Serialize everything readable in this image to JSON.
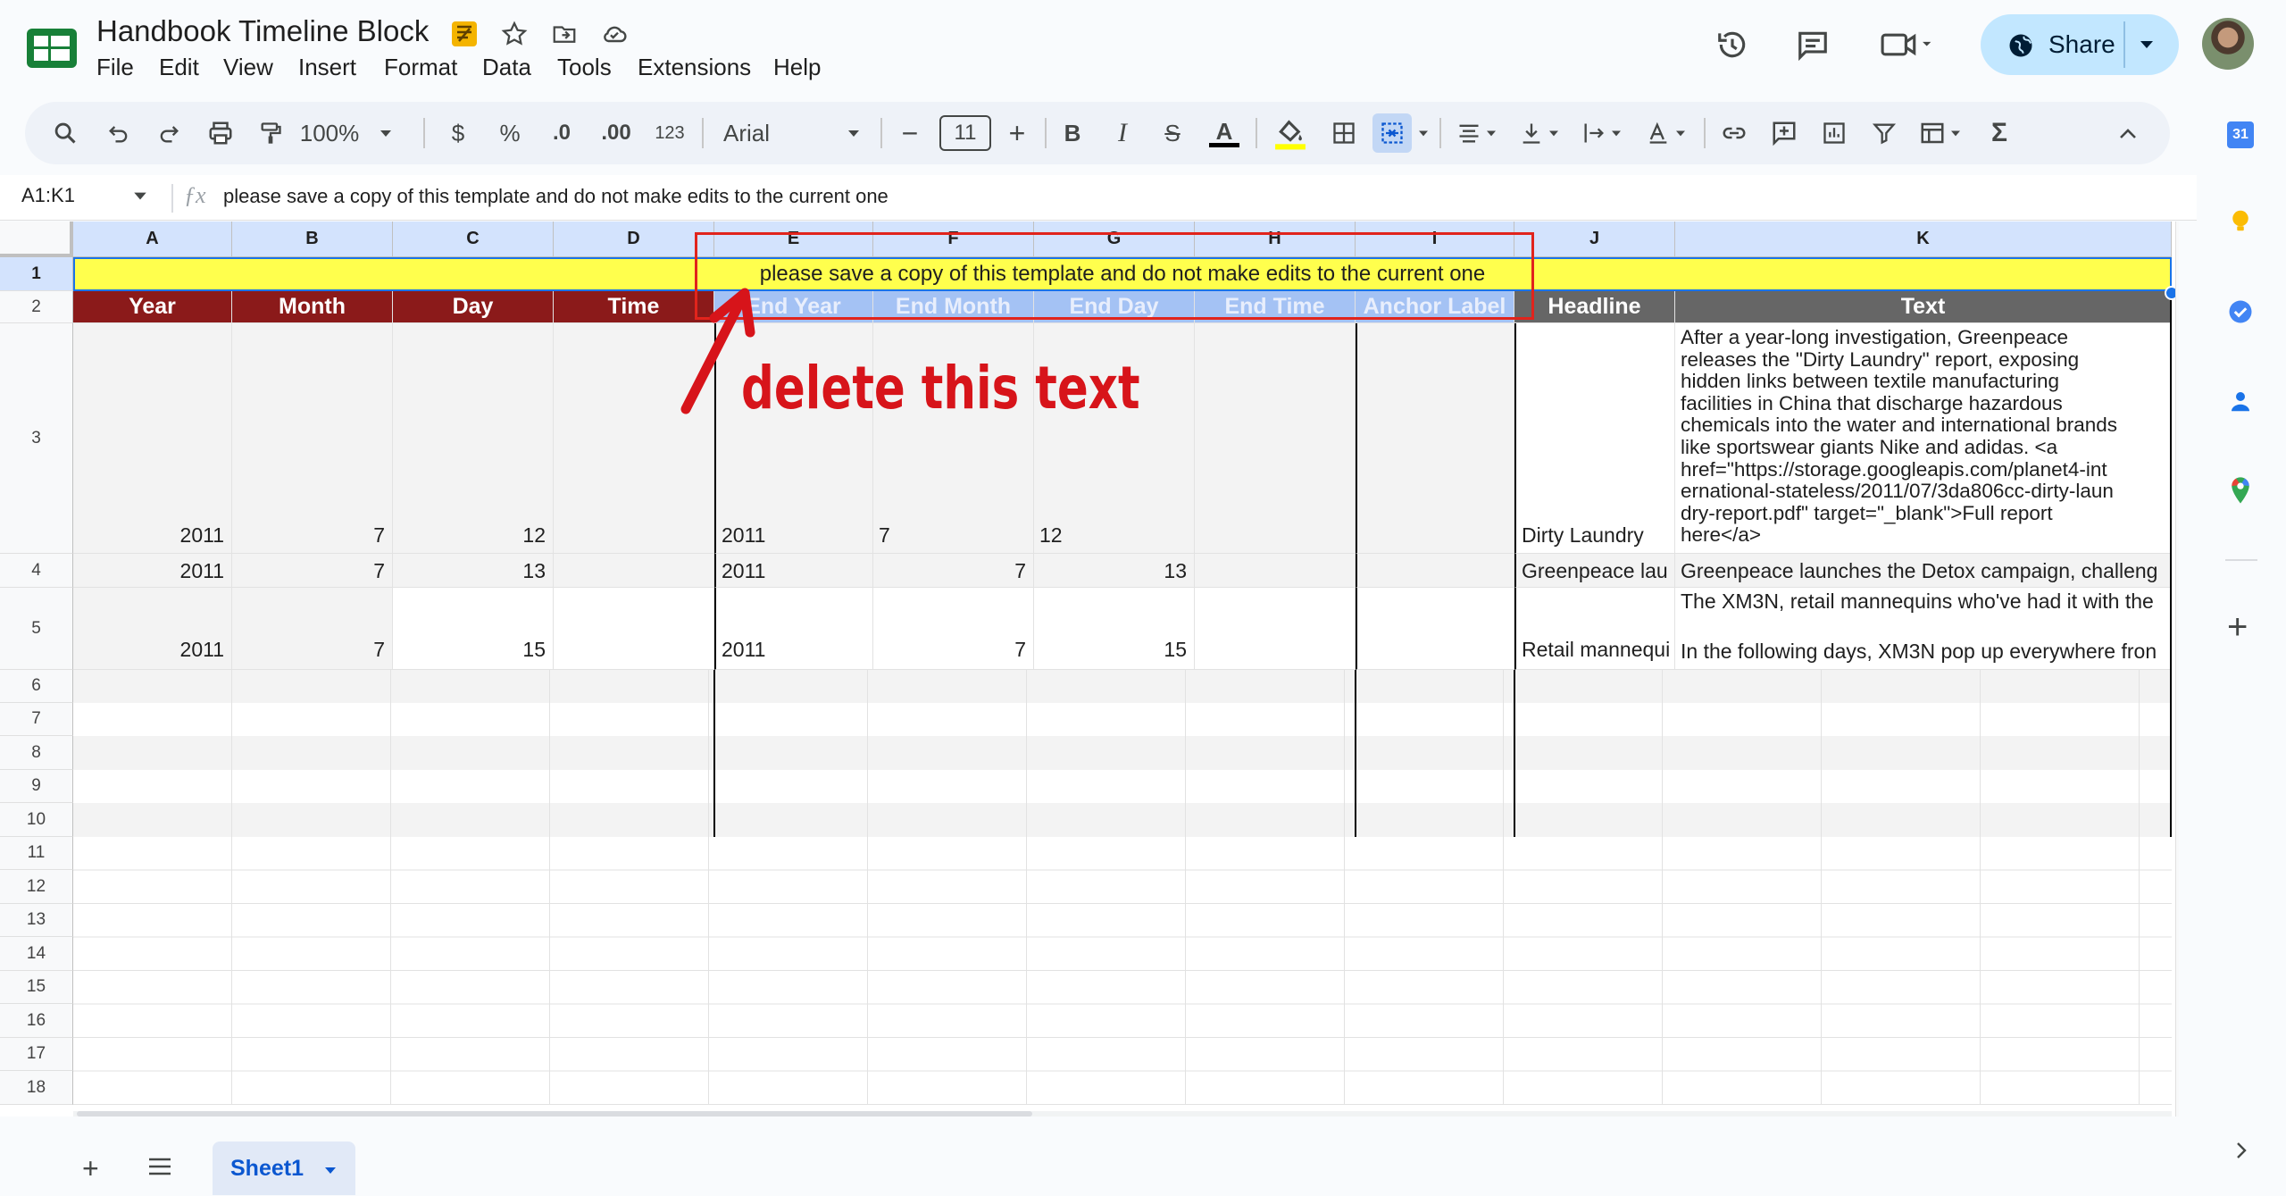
{
  "app": {
    "title": "Handbook Timeline Block",
    "menus": [
      "File",
      "Edit",
      "View",
      "Insert",
      "Format",
      "Data",
      "Tools",
      "Extensions",
      "Help"
    ],
    "share_label": "Share"
  },
  "toolbar": {
    "zoom": "100%",
    "currency": "$",
    "percent": "%",
    "dec_decrease": ".0",
    "dec_increase": ".00",
    "number_format": "123",
    "font": "Arial",
    "font_size": "11",
    "minus": "−",
    "plus": "+",
    "bold": "B",
    "italic": "I",
    "strike": "S",
    "text_color": "A",
    "sum": "Σ"
  },
  "formula_bar": {
    "name_box": "A1:K1",
    "content": "please save a copy of this template and do not make edits to the current one"
  },
  "sheet": {
    "columns": [
      "A",
      "B",
      "C",
      "D",
      "E",
      "F",
      "G",
      "H",
      "I",
      "J",
      "K"
    ],
    "row_numbers": [
      "1",
      "2",
      "3",
      "4",
      "5",
      "6",
      "7",
      "8",
      "9",
      "10",
      "11",
      "12",
      "13",
      "14",
      "15",
      "16",
      "17",
      "18"
    ],
    "banner": "please save a copy of this template and do not make edits to the current one",
    "headers": [
      "Year",
      "Month",
      "Day",
      "Time",
      "End Year",
      "End Month",
      "End Day",
      "End Time",
      "Anchor Label",
      "Headline",
      "Text"
    ],
    "row3": {
      "year": "2011",
      "month": "7",
      "day": "12",
      "end_year": "2011",
      "end_month": "7",
      "end_day": "12",
      "headline": "Dirty Laundry",
      "text_lines": [
        "After a year-long investigation, Greenpeace",
        "releases the \"Dirty Laundry\" report, exposing",
        "hidden links between textile manufacturing",
        "facilities in China that discharge hazardous",
        "chemicals into the water and international brands",
        "like sportswear giants Nike and adidas. <a",
        "href=\"https://storage.googleapis.com/planet4-int",
        "ernational-stateless/2011/07/3da806cc-dirty-laun",
        "dry-report.pdf\" target=\"_blank\">Full report",
        "here</a>"
      ]
    },
    "row4": {
      "year": "2011",
      "month": "7",
      "day": "13",
      "end_year": "2011",
      "end_month": "7",
      "end_day": "13",
      "headline": "Greenpeace lau",
      "text": "Greenpeace launches the Detox campaign, challeng"
    },
    "row5": {
      "year": "2011",
      "month": "7",
      "day": "15",
      "end_year": "2011",
      "end_month": "7",
      "end_day": "15",
      "headline": "Retail mannequi",
      "text_top": "The XM3N, retail mannequins who've had it with the",
      "text_bottom": "In the following days, XM3N pop up everywhere fron"
    },
    "sheet_tab": "Sheet1"
  },
  "annotation": {
    "label": "delete this text",
    "color": "#d7141a"
  },
  "colors": {
    "header_red": "#8b1a1a",
    "header_grey": "#666666",
    "header_blue": "#a4c2f4",
    "banner_yellow": "#ffff4d",
    "accent_blue": "#0b57d0"
  }
}
